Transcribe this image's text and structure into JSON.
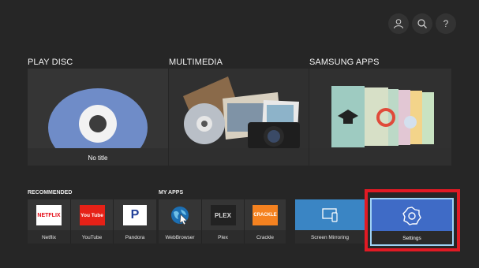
{
  "header": {
    "icons": [
      "user-icon",
      "search-icon",
      "help-icon"
    ],
    "help_glyph": "?"
  },
  "sections": {
    "play_disc": {
      "title": "PLAY DISC",
      "status": "No title"
    },
    "multimedia": {
      "title": "MULTIMEDIA"
    },
    "samsung_apps": {
      "title": "SAMSUNG APPS"
    }
  },
  "recommended": {
    "title": "RECOMMENDED",
    "tiles": [
      {
        "label": "Netflix",
        "logo": "NETFLIX",
        "color": "#e50914"
      },
      {
        "label": "YouTube",
        "logo": "You Tube",
        "color": "#e62117"
      },
      {
        "label": "Pandora",
        "logo": "P",
        "color": "#224099"
      }
    ]
  },
  "my_apps": {
    "title": "MY APPS",
    "tiles": [
      {
        "label": "WebBrowser",
        "logo": ""
      },
      {
        "label": "Plex",
        "logo": "PLEX"
      },
      {
        "label": "Crackle",
        "logo": "CRACKLE",
        "color": "#f58220"
      }
    ]
  },
  "system": {
    "screen_mirroring": {
      "label": "Screen Mirroring",
      "color": "#3a85c4"
    },
    "settings": {
      "label": "Settings",
      "color": "#3f6bc6",
      "highlight": "#e11a24"
    }
  }
}
